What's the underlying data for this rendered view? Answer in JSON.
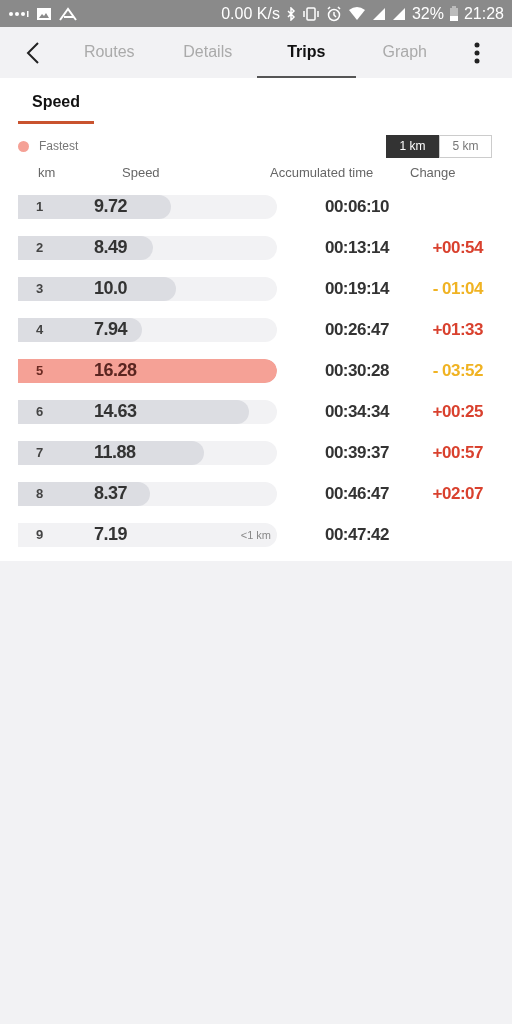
{
  "status_bar": {
    "speed": "0.00 K/s",
    "battery": "32%",
    "time": "21:28"
  },
  "tabs": [
    {
      "label": "Routes",
      "selected": false
    },
    {
      "label": "Details",
      "selected": false
    },
    {
      "label": "Trips",
      "selected": true
    },
    {
      "label": "Graph",
      "selected": false
    }
  ],
  "subtabs": [
    {
      "label": "Speed",
      "selected": true
    }
  ],
  "legend": {
    "label": "Fastest",
    "color": "#f5a196"
  },
  "units": [
    {
      "label": "1 km",
      "selected": true
    },
    {
      "label": "5 km",
      "selected": false
    }
  ],
  "columns": [
    "km",
    "Speed",
    "Accumulated time",
    "Change"
  ],
  "rows": [
    {
      "km": "1",
      "speed": "9.72",
      "level": 0.59,
      "fastest": false,
      "time": "00:06:10"
    },
    {
      "km": "2",
      "speed": "8.49",
      "level": 0.52,
      "fastest": false,
      "time": "00:13:14",
      "change": "+00:54",
      "kind": "slower"
    },
    {
      "km": "3",
      "speed": "10.0",
      "level": 0.61,
      "fastest": false,
      "time": "00:19:14",
      "change": "- 01:04",
      "kind": "faster"
    },
    {
      "km": "4",
      "speed": "7.94",
      "level": 0.48,
      "fastest": false,
      "time": "00:26:47",
      "change": "+01:33",
      "kind": "slower"
    },
    {
      "km": "5",
      "speed": "16.28",
      "level": 1,
      "fastest": true,
      "time": "00:30:28",
      "change": "- 03:52",
      "kind": "faster"
    },
    {
      "km": "6",
      "speed": "14.63",
      "level": 0.89,
      "fastest": false,
      "time": "00:34:34",
      "change": "+00:25",
      "kind": "slower"
    },
    {
      "km": "7",
      "speed": "11.88",
      "level": 0.72,
      "fastest": false,
      "time": "00:39:37",
      "change": "+00:57",
      "kind": "slower"
    },
    {
      "km": "8",
      "speed": "8.37",
      "level": 0.51,
      "fastest": false,
      "time": "00:46:47",
      "change": "+02:07",
      "kind": "slower"
    },
    {
      "km": "9",
      "speed": "7.19",
      "level": 0,
      "fastest": false,
      "time": "00:47:42",
      "note": "<1 km"
    }
  ]
}
